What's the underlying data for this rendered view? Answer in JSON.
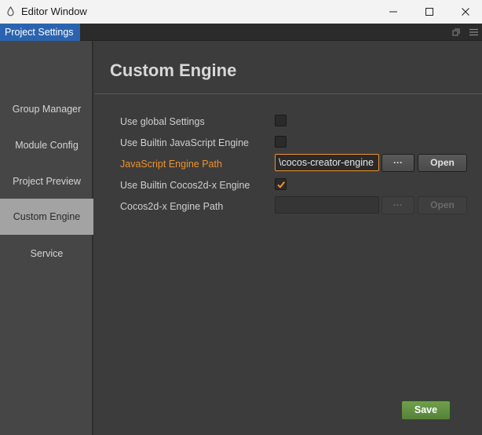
{
  "window": {
    "title": "Editor Window",
    "icon": "droplet-icon"
  },
  "tabs": [
    {
      "label": "Project Settings",
      "active": true
    }
  ],
  "sidebar": {
    "items": [
      {
        "label": "Group Manager",
        "active": false
      },
      {
        "label": "Module Config",
        "active": false
      },
      {
        "label": "Project Preview",
        "active": false
      },
      {
        "label": "Custom Engine",
        "active": true
      },
      {
        "label": "Service",
        "active": false
      }
    ]
  },
  "main": {
    "title": "Custom Engine",
    "rows": {
      "use_global": {
        "label": "Use global Settings",
        "checked": false
      },
      "use_builtin_js": {
        "label": "Use Builtin JavaScript Engine",
        "checked": false
      },
      "js_path": {
        "label": "JavaScript Engine Path",
        "value": "\\cocos-creator-engine",
        "browse_label": "···",
        "open_label": "Open"
      },
      "use_builtin_cocos2dx": {
        "label": "Use Builtin Cocos2d-x Engine",
        "checked": true
      },
      "cocos2dx_path": {
        "label": "Cocos2d-x Engine Path",
        "value": "",
        "browse_label": "···",
        "open_label": "Open"
      }
    },
    "save_label": "Save"
  },
  "colors": {
    "accent_orange": "#f0922a",
    "tab_blue": "#2a64b0",
    "save_green": "#5e8f3f"
  }
}
